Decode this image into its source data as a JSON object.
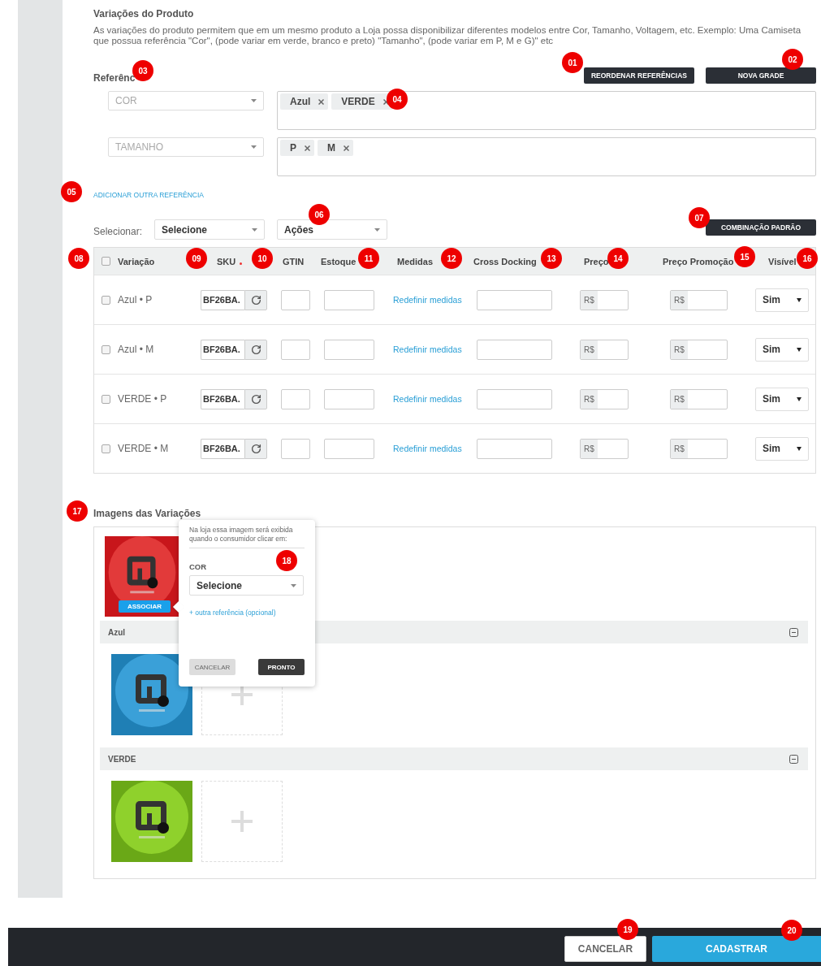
{
  "section": {
    "title": "Variações do Produto",
    "description": "As variações do produto permitem que em um mesmo produto a Loja possa disponibilizar diferentes modelos entre Cor, Tamanho, Voltagem, etc. Exemplo: Uma Camiseta que possua referência \"Cor\", (pode variar em verde, branco e preto) \"Tamanho\", (pode variar em P, M e G)\" etc"
  },
  "references": {
    "label": "Referênc",
    "buttons": [
      "REORDENAR REFERÊNCIAS",
      "NOVA GRADE"
    ],
    "rows": [
      {
        "name": "COR",
        "tags": [
          "Azul",
          "VERDE"
        ]
      },
      {
        "name": "TAMANHO",
        "tags": [
          "P",
          "M"
        ]
      }
    ],
    "add_link": "ADICIONAR OUTRA REFERÊNCIA"
  },
  "toolbar": {
    "label": "Selecionar:",
    "selects": [
      "Selecione",
      "Ações"
    ],
    "button": "COMBINAÇÃO PADRÃO"
  },
  "table": {
    "select_all_checked": false,
    "columns": [
      {
        "label": "Variação",
        "required": false
      },
      {
        "label": "SKU",
        "required": true
      },
      {
        "label": "GTIN",
        "required": false
      },
      {
        "label": "Estoque",
        "required": false
      },
      {
        "label": "Medidas",
        "required": false
      },
      {
        "label": "Cross Docking",
        "required": false
      },
      {
        "label": "Preço",
        "required": false
      },
      {
        "label": "Preço Promoção",
        "required": false
      },
      {
        "label": "Visível",
        "required": false
      }
    ],
    "rows": [
      {
        "variation": "Azul • P",
        "checked": false,
        "sku": "BF26BA.",
        "link": "Redefinir medidas",
        "price_prefix": "R$",
        "promo_prefix": "R$",
        "visible": "Sim"
      },
      {
        "variation": "Azul • M",
        "checked": false,
        "sku": "BF26BA.",
        "link": "Redefinir medidas",
        "price_prefix": "R$",
        "promo_prefix": "R$",
        "visible": "Sim"
      },
      {
        "variation": "VERDE • P",
        "checked": false,
        "sku": "BF26BA.",
        "link": "Redefinir medidas",
        "price_prefix": "R$",
        "promo_prefix": "R$",
        "visible": "Sim"
      },
      {
        "variation": "VERDE • M",
        "checked": false,
        "sku": "BF26BA.",
        "link": "Redefinir medidas",
        "price_prefix": "R$",
        "promo_prefix": "R$",
        "visible": "Sim"
      }
    ]
  },
  "images": {
    "title": "Imagens das Variações",
    "associate_button": "ASSOCIAR",
    "groups": [
      {
        "name": "Azul",
        "expanded": true
      },
      {
        "name": "VERDE",
        "expanded": true
      }
    ],
    "popup": {
      "text": "Na loja essa imagem será exibida quando o consumidor clicar em:",
      "field_label": "COR",
      "select": "Selecione",
      "link": "+ outra referência (opcional)",
      "buttons": [
        {
          "label": "CANCELAR",
          "kind": "secondary"
        },
        {
          "label": "PRONTO",
          "kind": "primary"
        }
      ]
    }
  },
  "footer": {
    "buttons": [
      {
        "label": "CANCELAR",
        "kind": "secondary"
      },
      {
        "label": "CADASTRAR",
        "kind": "primary"
      }
    ]
  },
  "markers": [
    "01",
    "02",
    "03",
    "04",
    "05",
    "06",
    "07",
    "08",
    "09",
    "10",
    "11",
    "12",
    "13",
    "14",
    "15",
    "16",
    "17",
    "18",
    "19",
    "20"
  ]
}
